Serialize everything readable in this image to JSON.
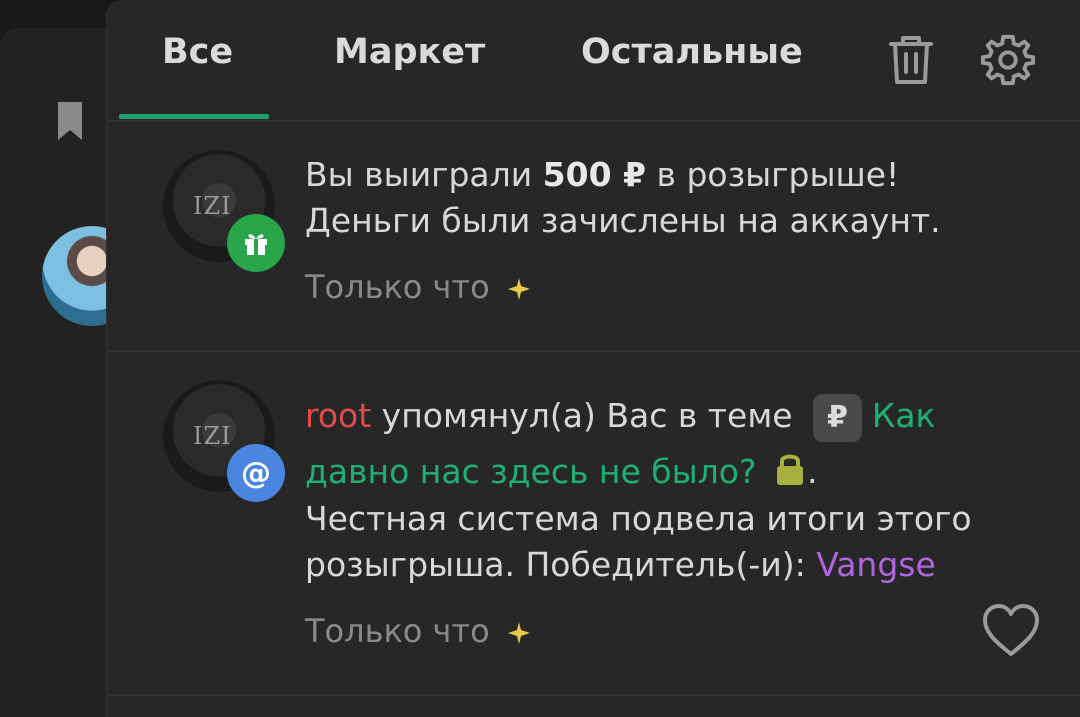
{
  "tabs": [
    {
      "label": "Все"
    },
    {
      "label": "Маркет"
    },
    {
      "label": "Остальные"
    }
  ],
  "icons": {
    "bookmark": "bookmark-icon",
    "trash": "trash-icon",
    "settings": "gear-icon",
    "gift": "gift-icon",
    "mention": "at-icon",
    "lock": "lock-icon",
    "heart": "heart-icon",
    "spark": "sparkle-icon"
  },
  "colors": {
    "accent": "#1fa06c",
    "user": "#e04a4a",
    "thread": "#1fb074",
    "winner": "#b065e0",
    "gift_badge": "#2aa64a",
    "mention_badge": "#4a86e0",
    "lock": "#a8b040"
  },
  "notifications": [
    {
      "avatar_mark": "IZI",
      "text_before": "Вы выиграли ",
      "amount": "500 ₽",
      "text_after": " в розыгрыше!",
      "line2": "Деньги были зачислены на аккаунт.",
      "time": "Только что"
    },
    {
      "avatar_mark": "IZI",
      "user": "root",
      "action": " упомянул(а) Вас в теме ",
      "prefix": "₽",
      "thread_line1": "Как",
      "thread_line2": "давно нас здесь не было?",
      "after_lock": ".",
      "body_line1": "Честная система подвела итоги этого",
      "body_line2": "розыгрыша. Победитель(-и): ",
      "winner": "Vangse",
      "time": "Только что"
    }
  ]
}
